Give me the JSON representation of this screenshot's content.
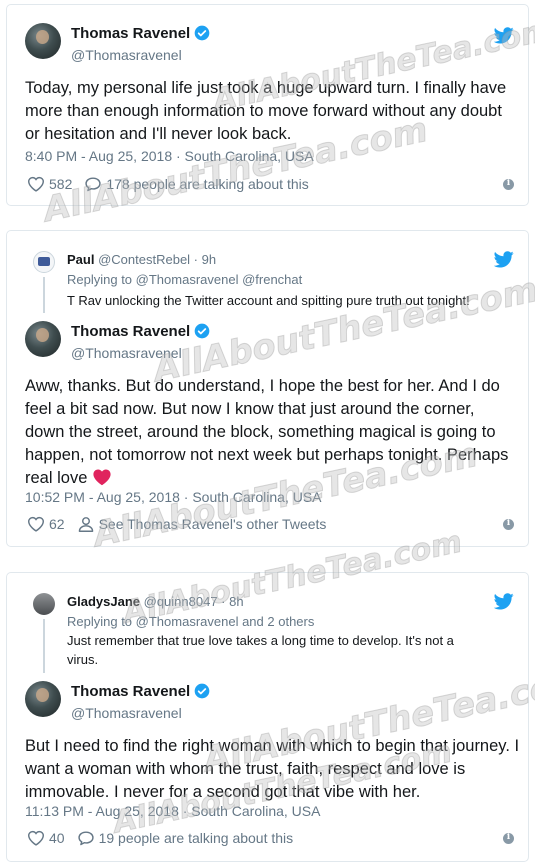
{
  "colors": {
    "twitter_blue": "#1da1f2",
    "heart_red": "#e0245e",
    "muted": "#657786",
    "border": "#e1e8ed"
  },
  "watermark": {
    "text": "AllAboutTheTea.com"
  },
  "tweets": [
    {
      "name": "Thomas Ravenel",
      "handle": "@Thomasravenel",
      "text": "Today, my personal life just took a huge upward turn.  I finally have more than enough information to move forward without any doubt or hesitation and I'll never look back.",
      "meta": "8:40 PM - Aug 25, 2018 · South Carolina, USA",
      "likes": "582",
      "secondary_action": "178 people are talking about this",
      "secondary_icon": "comment-icon"
    },
    {
      "reply": {
        "name": "Paul",
        "handle": "@ContestRebel · 9h",
        "replying_label": "Replying to",
        "replying_to": "@Thomasravenel @frenchat",
        "text": "T Rav unlocking the Twitter account and spitting pure truth out tonight!"
      },
      "name": "Thomas Ravenel",
      "handle": "@Thomasravenel",
      "text": "Aww, thanks. But do understand, I hope the best for her. And I do feel a bit sad now. But now I know that just around the corner, down the street, around the block, something magical is going to happen, not tomorrow not next week but perhaps tonight. Perhaps real love",
      "meta": "10:52 PM - Aug 25, 2018 · South Carolina, USA",
      "likes": "62",
      "secondary_action": "See Thomas Ravenel's other Tweets",
      "secondary_icon": "person-icon"
    },
    {
      "reply": {
        "name": "GladysJane",
        "handle": "@quinn8047 · 8h",
        "replying_label": "Replying to",
        "replying_to": "@Thomasravenel and 2 others",
        "text": "Just remember that true love takes a long time to develop. It's not a virus."
      },
      "name": "Thomas Ravenel",
      "handle": "@Thomasravenel",
      "text": "But I need to find the right woman with which to begin that journey. I want a woman with whom the trust, faith, respect and love is immovable.   I never for a second got that vibe with her.",
      "meta": "11:13 PM - Aug 25, 2018 · South Carolina, USA",
      "likes": "40",
      "secondary_action": "19 people are talking about this",
      "secondary_icon": "comment-icon"
    }
  ]
}
